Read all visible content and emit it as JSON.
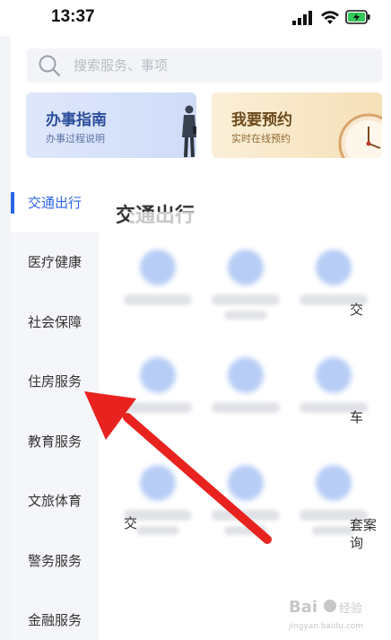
{
  "status_bar": {
    "time": "13:37"
  },
  "search": {
    "placeholder": "搜索服务、事项"
  },
  "cards": [
    {
      "title": "办事指南",
      "subtitle": "办事过程说明"
    },
    {
      "title": "我要预约",
      "subtitle": "实时在线预约"
    }
  ],
  "sidebar": {
    "items": [
      {
        "label": "交通出行",
        "active": true
      },
      {
        "label": "医疗健康"
      },
      {
        "label": "社会保障"
      },
      {
        "label": "住房服务"
      },
      {
        "label": "教育服务"
      },
      {
        "label": "文旅体育"
      },
      {
        "label": "警务服务"
      },
      {
        "label": "金融服务"
      }
    ]
  },
  "content": {
    "title": "交通出行",
    "visible_fragments": [
      "交",
      "车",
      "套案",
      "询",
      "交"
    ]
  },
  "colors": {
    "accent": "#2c66e8",
    "arrow": "#e8231f"
  },
  "watermark_text": "Bai 经验 jingyan.baidu.com"
}
